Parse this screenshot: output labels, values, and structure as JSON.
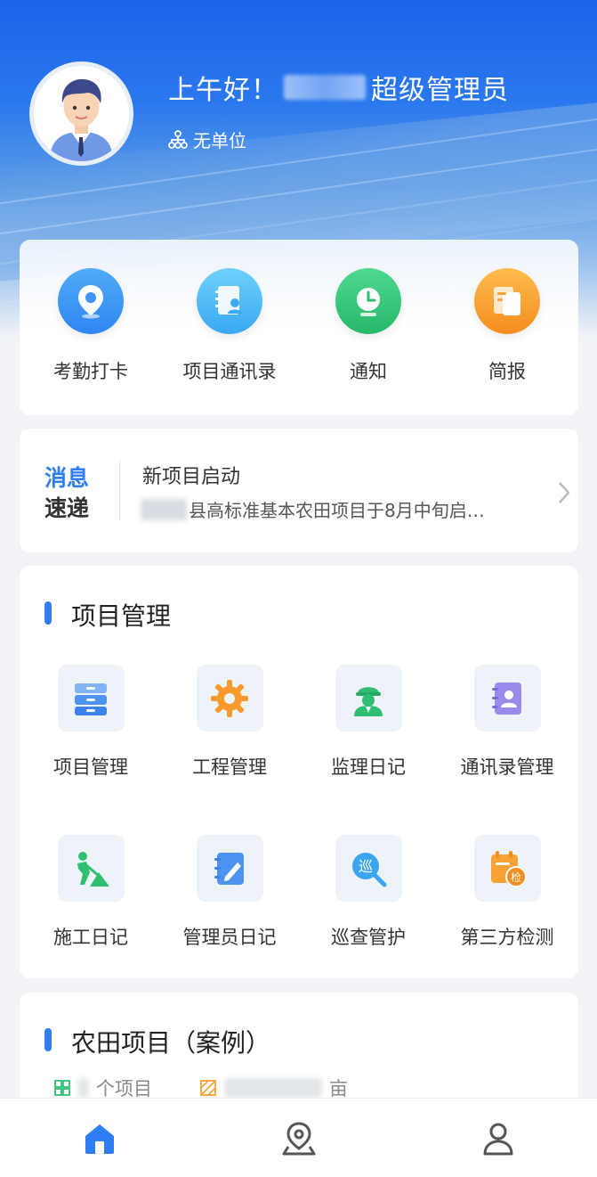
{
  "header": {
    "greeting_prefix": "上午好！",
    "greeting_suffix": "超级管理员",
    "unit": "无单位"
  },
  "quick_actions": [
    {
      "label": "考勤打卡",
      "icon": "location-pin-icon",
      "color": "#2f8af5"
    },
    {
      "label": "项目通讯录",
      "icon": "contact-book-icon",
      "color": "#49b6f5"
    },
    {
      "label": "通知",
      "icon": "clock-icon",
      "color": "#35c97a"
    },
    {
      "label": "简报",
      "icon": "document-icon",
      "color": "#f7a234"
    }
  ],
  "news": {
    "tag_line1": "消息",
    "tag_line2": "速递",
    "title": "新项目启动",
    "desc": "县高标准基本农田项目于8月中旬启…"
  },
  "project_section": {
    "title": "项目管理",
    "items": [
      {
        "label": "项目管理",
        "icon": "cabinet-icon"
      },
      {
        "label": "工程管理",
        "icon": "gear-icon"
      },
      {
        "label": "监理日记",
        "icon": "worker-helmet-icon"
      },
      {
        "label": "通讯录管理",
        "icon": "contact-card-icon"
      },
      {
        "label": "施工日记",
        "icon": "shovel-worker-icon"
      },
      {
        "label": "管理员日记",
        "icon": "notebook-pen-icon"
      },
      {
        "label": "巡查管护",
        "icon": "patrol-search-icon"
      },
      {
        "label": "第三方检测",
        "icon": "inspection-calendar-icon"
      }
    ]
  },
  "farm_section": {
    "title": "农田项目（案例）",
    "stat_projects": "个项目",
    "stat_area": "亩"
  },
  "bottom_nav": [
    {
      "name": "home",
      "icon": "home-icon",
      "active": true
    },
    {
      "name": "map",
      "icon": "map-pin-icon",
      "active": false
    },
    {
      "name": "profile",
      "icon": "user-icon",
      "active": false
    }
  ],
  "colors": {
    "accent": "#2f7ef5",
    "header_blue": "#1c64ea"
  }
}
